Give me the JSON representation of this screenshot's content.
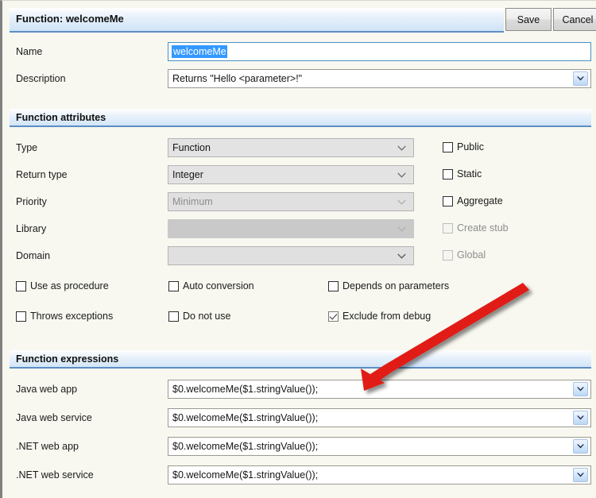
{
  "window": {
    "title": "Function: welcomeMe",
    "save_label": "Save",
    "cancel_label": "Cancel",
    "help_glyph": "?"
  },
  "top_fields": {
    "name_label": "Name",
    "name_value": "welcomeMe",
    "description_label": "Description",
    "description_value": "Returns \"Hello <parameter>!\""
  },
  "attributes_section": {
    "header": "Function attributes",
    "rows": [
      {
        "label": "Type",
        "value": "Function",
        "disabled": false,
        "empty": false
      },
      {
        "label": "Return type",
        "value": "Integer",
        "disabled": false,
        "empty": false
      },
      {
        "label": "Priority",
        "value": "Minimum",
        "disabled": true,
        "empty": false
      },
      {
        "label": "Library",
        "value": "",
        "disabled": true,
        "empty": true
      },
      {
        "label": "Domain",
        "value": "",
        "disabled": false,
        "empty": true
      }
    ],
    "side_checkboxes": [
      {
        "label": "Public",
        "checked": false,
        "disabled": false
      },
      {
        "label": "Static",
        "checked": false,
        "disabled": false
      },
      {
        "label": "Aggregate",
        "checked": false,
        "disabled": false
      },
      {
        "label": "Create stub",
        "checked": false,
        "disabled": true
      },
      {
        "label": "Global",
        "checked": false,
        "disabled": true
      }
    ],
    "bottom_checkboxes": [
      {
        "label": "Use as procedure",
        "checked": false,
        "disabled": false
      },
      {
        "label": "Auto conversion",
        "checked": false,
        "disabled": false
      },
      {
        "label": "Depends on parameters",
        "checked": false,
        "disabled": false
      },
      {
        "label": "Throws exceptions",
        "checked": false,
        "disabled": false
      },
      {
        "label": "Do not use",
        "checked": false,
        "disabled": false
      },
      {
        "label": "Exclude from debug",
        "checked": true,
        "disabled": false
      }
    ]
  },
  "expressions_section": {
    "header": "Function expressions",
    "rows": [
      {
        "label": "Java web app",
        "value": "$0.welcomeMe($1.stringValue());"
      },
      {
        "label": "Java web service",
        "value": "$0.welcomeMe($1.stringValue());"
      },
      {
        "label": ".NET web app",
        "value": "$0.welcomeMe($1.stringValue());"
      },
      {
        "label": ".NET web service",
        "value": "$0.welcomeMe($1.stringValue());"
      }
    ]
  },
  "annotation": {
    "type": "arrow",
    "color": "#e11b18",
    "points_at": "Java web app expression field"
  }
}
